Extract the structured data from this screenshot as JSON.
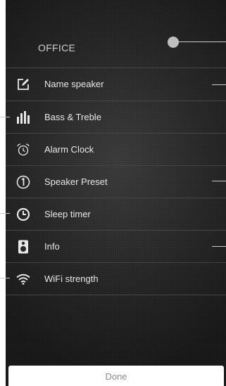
{
  "header": {
    "title": "OFFICE"
  },
  "menu": {
    "items": [
      {
        "label": "Name speaker",
        "icon": "edit-icon"
      },
      {
        "label": "Bass & Treble",
        "icon": "equalizer-icon"
      },
      {
        "label": "Alarm Clock",
        "icon": "alarm-clock-icon"
      },
      {
        "label": "Speaker Preset",
        "icon": "preset-one-icon"
      },
      {
        "label": "Sleep timer",
        "icon": "clock-icon"
      },
      {
        "label": "Info",
        "icon": "speaker-icon"
      },
      {
        "label": "WiFi strength",
        "icon": "wifi-icon"
      }
    ]
  },
  "footer": {
    "done_label": "Done"
  },
  "colors": {
    "panel_background": "#262626",
    "text": "#e8e8e8",
    "divider": "#454545",
    "callout": "#c8c8c8",
    "done_text": "#8a8a8a"
  }
}
